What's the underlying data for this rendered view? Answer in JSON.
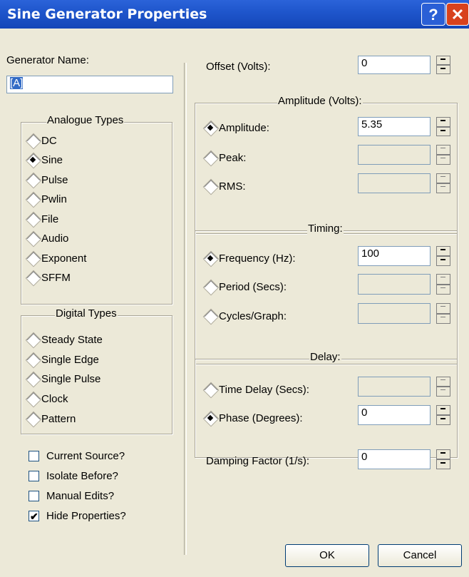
{
  "window": {
    "title": "Sine Generator Properties",
    "help_label": "?",
    "close_label": "✕"
  },
  "generator": {
    "label": "Generator Name:",
    "value": "[A]"
  },
  "analogue": {
    "title": "Analogue Types",
    "items": [
      "DC",
      "Sine",
      "Pulse",
      "Pwlin",
      "File",
      "Audio",
      "Exponent",
      "SFFM"
    ],
    "selected": "Sine"
  },
  "digital": {
    "title": "Digital Types",
    "items": [
      "Steady State",
      "Single Edge",
      "Single Pulse",
      "Clock",
      "Pattern"
    ]
  },
  "checks": [
    {
      "label": "Current Source?",
      "checked": false
    },
    {
      "label": "Isolate Before?",
      "checked": false
    },
    {
      "label": "Manual Edits?",
      "checked": false
    },
    {
      "label": "Hide Properties?",
      "checked": true
    }
  ],
  "offset": {
    "label": "Offset (Volts):",
    "value": "0"
  },
  "amplitude": {
    "title": "Amplitude (Volts):",
    "amplitude_label": "Amplitude:",
    "amplitude_value": "5.35",
    "peak_label": "Peak:",
    "rms_label": "RMS:"
  },
  "timing": {
    "title": "Timing:",
    "frequency_label": "Frequency (Hz):",
    "frequency_value": "100",
    "period_label": "Period (Secs):",
    "cycles_label": "Cycles/Graph:"
  },
  "delay": {
    "title": "Delay:",
    "time_delay_label": "Time Delay (Secs):",
    "phase_label": "Phase (Degrees):",
    "phase_value": "0"
  },
  "damping": {
    "label": "Damping Factor (1/s):",
    "value": "0"
  },
  "buttons": {
    "ok": "OK",
    "cancel": "Cancel"
  },
  "colors": {
    "titlebar": "#1f56cc",
    "face": "#ece9d8",
    "close": "#d8421d"
  }
}
